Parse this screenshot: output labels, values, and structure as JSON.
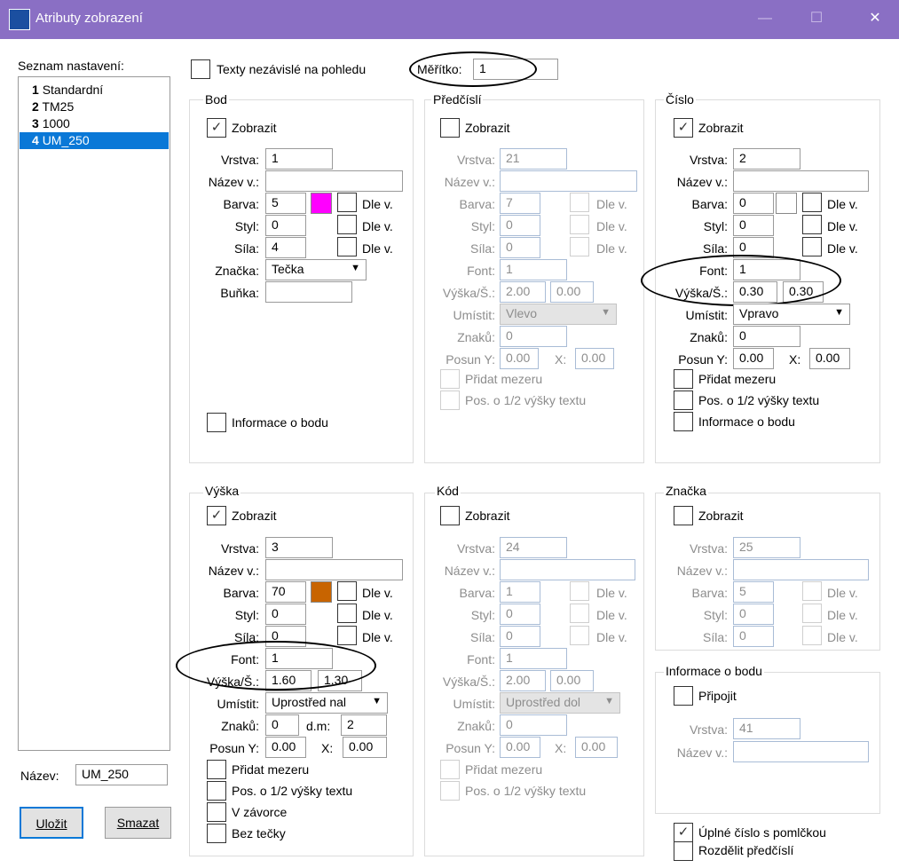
{
  "window": {
    "title": "Atributy zobrazení",
    "min": "—",
    "max": "☐",
    "close": "✕"
  },
  "left": {
    "list_label": "Seznam nastavení:",
    "items": [
      {
        "num": "1",
        "name": "Standardní"
      },
      {
        "num": "2",
        "name": "TM25"
      },
      {
        "num": "3",
        "name": "1000"
      },
      {
        "num": "4",
        "name": "UM_250"
      }
    ],
    "name_label": "Název:",
    "name_value": "UM_250",
    "save": "Uložit",
    "delete": "Smazat"
  },
  "top": {
    "independent_label": "Texty nezávislé na pohledu",
    "scale_label": "Měřítko:",
    "scale_value": "1"
  },
  "bod": {
    "title": "Bod",
    "show": "Zobrazit",
    "show_checked": "✓",
    "vrstva_label": "Vrstva:",
    "vrstva": "1",
    "nazev_label": "Název v.:",
    "nazev": "",
    "barva_label": "Barva:",
    "barva": "5",
    "barva_color": "#ff00ff",
    "dlev": "Dle v.",
    "styl_label": "Styl:",
    "styl": "0",
    "sila_label": "Síla:",
    "sila": "4",
    "znacka_label": "Značka:",
    "znacka": "Tečka",
    "bunka_label": "Buňka:",
    "bunka": "",
    "info": "Informace o bodu"
  },
  "predcisli": {
    "title": "Předčíslí",
    "show": "Zobrazit",
    "vrstva_label": "Vrstva:",
    "vrstva": "21",
    "nazev_label": "Název v.:",
    "nazev": "",
    "barva_label": "Barva:",
    "barva": "7",
    "dlev": "Dle v.",
    "styl_label": "Styl:",
    "styl": "0",
    "sila_label": "Síla:",
    "sila": "0",
    "font_label": "Font:",
    "font": "1",
    "vs_label": "Výška/Š.:",
    "vyska": "2.00",
    "sirka": "0.00",
    "umistit_label": "Umístit:",
    "umistit": "Vlevo",
    "znaku_label": "Znaků:",
    "znaku": "0",
    "posun_label": "Posun Y:",
    "posun_y": "0.00",
    "x_label": "X:",
    "posun_x": "0.00",
    "mezera": "Přidat mezeru",
    "pos12": "Pos. o 1/2 výšky textu"
  },
  "cislo": {
    "title": "Číslo",
    "show": "Zobrazit",
    "show_checked": "✓",
    "vrstva_label": "Vrstva:",
    "vrstva": "2",
    "nazev_label": "Název v.:",
    "nazev": "",
    "barva_label": "Barva:",
    "barva": "0",
    "barva_color": "#ffffff",
    "dlev": "Dle v.",
    "styl_label": "Styl:",
    "styl": "0",
    "sila_label": "Síla:",
    "sila": "0",
    "font_label": "Font:",
    "font": "1",
    "vs_label": "Výška/Š.:",
    "vyska": "0.30",
    "sirka": "0.30",
    "umistit_label": "Umístit:",
    "umistit": "Vpravo",
    "znaku_label": "Znaků:",
    "znaku": "0",
    "posun_label": "Posun Y:",
    "posun_y": "0.00",
    "x_label": "X:",
    "posun_x": "0.00",
    "mezera": "Přidat mezeru",
    "pos12": "Pos. o 1/2 výšky textu",
    "info": "Informace o bodu"
  },
  "vyska": {
    "title": "Výška",
    "show": "Zobrazit",
    "show_checked": "✓",
    "vrstva_label": "Vrstva:",
    "vrstva": "3",
    "nazev_label": "Název v.:",
    "nazev": "",
    "barva_label": "Barva:",
    "barva": "70",
    "barva_color": "#c86400",
    "dlev": "Dle v.",
    "styl_label": "Styl:",
    "styl": "0",
    "sila_label": "Síla:",
    "sila": "0",
    "font_label": "Font:",
    "font": "1",
    "vs_label": "Výška/Š.:",
    "vyska": "1.60",
    "sirka": "1.30",
    "umistit_label": "Umístit:",
    "umistit": "Uprostřed nal",
    "znaku_label": "Znaků:",
    "znaku": "0",
    "dm_label": "d.m:",
    "dm": "2",
    "posun_label": "Posun Y:",
    "posun_y": "0.00",
    "x_label": "X:",
    "posun_x": "0.00",
    "mezera": "Přidat mezeru",
    "pos12": "Pos. o 1/2 výšky textu",
    "zavorce": "V závorce",
    "bez": "Bez tečky"
  },
  "kod": {
    "title": "Kód",
    "show": "Zobrazit",
    "vrstva_label": "Vrstva:",
    "vrstva": "24",
    "nazev_label": "Název v.:",
    "nazev": "",
    "barva_label": "Barva:",
    "barva": "1",
    "dlev": "Dle v.",
    "styl_label": "Styl:",
    "styl": "0",
    "sila_label": "Síla:",
    "sila": "0",
    "font_label": "Font:",
    "font": "1",
    "vs_label": "Výška/Š.:",
    "vyska": "2.00",
    "sirka": "0.00",
    "umistit_label": "Umístit:",
    "umistit": "Uprostřed dol",
    "znaku_label": "Znaků:",
    "znaku": "0",
    "posun_label": "Posun Y:",
    "posun_y": "0.00",
    "x_label": "X:",
    "posun_x": "0.00",
    "mezera": "Přidat mezeru",
    "pos12": "Pos. o 1/2 výšky textu"
  },
  "znacka": {
    "title": "Značka",
    "show": "Zobrazit",
    "vrstva_label": "Vrstva:",
    "vrstva": "25",
    "nazev_label": "Název v.:",
    "nazev": "",
    "barva_label": "Barva:",
    "barva": "5",
    "dlev": "Dle v.",
    "styl_label": "Styl:",
    "styl": "0",
    "sila_label": "Síla:",
    "sila": "0"
  },
  "infobod": {
    "title": "Informace o bodu",
    "pripojit": "Připojit",
    "vrstva_label": "Vrstva:",
    "vrstva": "41",
    "nazev_label": "Název v.:",
    "nazev": ""
  },
  "bottom": {
    "uplne": "Úplné číslo s pomlčkou",
    "uplne_checked": "✓",
    "rozdelit": "Rozdělit předčíslí"
  }
}
